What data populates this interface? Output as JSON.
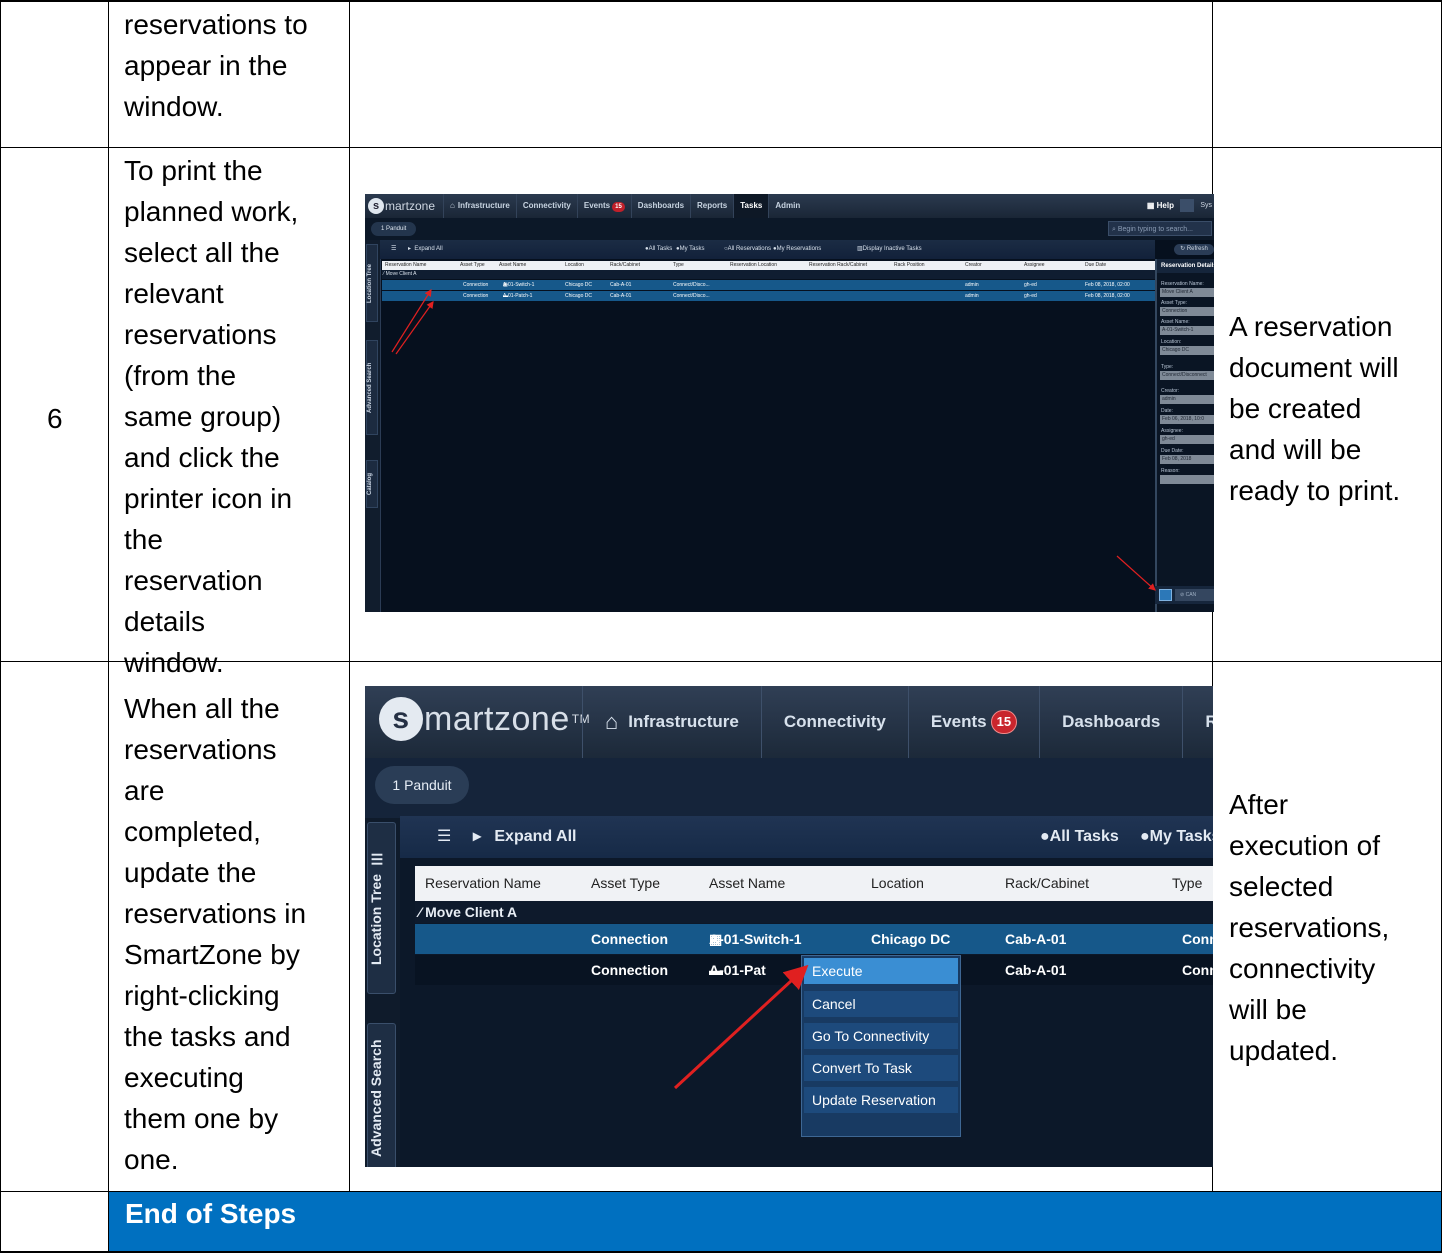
{
  "rows": [
    {
      "step": "",
      "instruction_lines": [
        "reservations to",
        "appear in the",
        "window."
      ],
      "result_lines": []
    },
    {
      "step": "6",
      "instruction_lines": [
        "To print the",
        "planned work,",
        "select all the",
        "relevant",
        "reservations",
        "(from the",
        "same group)",
        "and click the",
        "printer icon in",
        "the",
        "reservation",
        "details",
        "window."
      ],
      "result_lines": [
        "A reservation",
        "document will",
        "be created",
        "and will be",
        "ready to print."
      ]
    },
    {
      "step": "",
      "instruction_lines": [
        "When all the",
        "reservations",
        "are",
        "completed,",
        "update the",
        "reservations in",
        "SmartZone by",
        "right-clicking",
        "the tasks and",
        "executing",
        "them one by",
        "one."
      ],
      "result_lines": [
        "After",
        "execution of",
        "selected",
        "reservations,",
        "connectivity",
        "will be",
        "updated."
      ]
    }
  ],
  "end_banner": "End of Steps",
  "colors": {
    "banner": "#0070c0",
    "row_highlight": "#16588a",
    "menu_hover": "#3a8ed3",
    "badge": "#c9262d",
    "arrow": "#e02020"
  },
  "screenshot1": {
    "logo": "martzone",
    "logo_s": "s",
    "nav": [
      "Infrastructure",
      "Connectivity",
      "Events",
      "Dashboards",
      "Reports",
      "Tasks",
      "Admin"
    ],
    "events_badge": "15",
    "help": "Help",
    "user": "Sys",
    "location_chip": "1 Panduit",
    "search_placeholder": "Begin typing to search...",
    "toolbar": {
      "expand": "Expand All",
      "all_tasks": "All Tasks",
      "my_tasks": "My Tasks",
      "all_res": "All Reservations",
      "my_res": "My Reservations",
      "inactive": "Display Inactive Tasks",
      "refresh": "Refresh"
    },
    "columns": [
      "Reservation Name",
      "Asset Type",
      "Asset Name",
      "Location",
      "Rack/Cabinet",
      "Type",
      "Reservation Location",
      "Reservation Rack/Cabinet",
      "Rack Position",
      "Creator",
      "Assignee",
      "Due Date"
    ],
    "group": "Move Client A",
    "rows": [
      {
        "asset_type": "Connection",
        "asset_name": "A-01-Switch-1",
        "location": "Chicago DC",
        "rack": "Cab-A-01",
        "type": "Connect/Disco...",
        "creator": "admin",
        "assignee": "gh-ed",
        "due": "Feb 08, 2018, 02:00"
      },
      {
        "asset_type": "Connection",
        "asset_name": "A-01-Patch-1",
        "location": "Chicago DC",
        "rack": "Cab-A-01",
        "type": "Connect/Disco...",
        "creator": "admin",
        "assignee": "gh-ed",
        "due": "Feb 08, 2018, 02:00"
      }
    ],
    "side_tabs": [
      "Location Tree",
      "Advanced Search",
      "Catalog"
    ],
    "details": {
      "title": "Reservation Details",
      "fields": [
        {
          "label": "Reservation Name:",
          "value": "Move Client A"
        },
        {
          "label": "Asset Type:",
          "value": "Connection"
        },
        {
          "label": "Asset Name:",
          "value": "A-01-Switch-1"
        },
        {
          "label": "Location:",
          "value": "Chicago DC"
        },
        {
          "label": "Type:",
          "value": "Connect/Disconnect"
        },
        {
          "label": "Creator:",
          "value": "admin"
        },
        {
          "label": "Date:",
          "value": "Feb 06, 2018, 10:0"
        },
        {
          "label": "Assignee:",
          "value": "gh-ed"
        },
        {
          "label": "Due Date:",
          "value": "Feb 08, 2018"
        },
        {
          "label": "Reason:",
          "value": ""
        }
      ],
      "cancel": "CAN"
    }
  },
  "screenshot2": {
    "logo": "martzone",
    "logo_s": "s",
    "logo_tm": "TM",
    "nav": [
      "Infrastructure",
      "Connectivity",
      "Events",
      "Dashboards",
      "Re"
    ],
    "events_badge": "15",
    "location_chip": "1 Panduit",
    "toolbar": {
      "expand": "Expand All",
      "all_tasks": "All Tasks",
      "my_tasks": "My Tasks"
    },
    "columns": [
      "Reservation Name",
      "Asset Type",
      "Asset Name",
      "Location",
      "Rack/Cabinet",
      "Type"
    ],
    "group": "Move Client A",
    "rows": [
      {
        "asset_type": "Connection",
        "asset_name": "A-01-Switch-1",
        "location": "Chicago DC",
        "rack": "Cab-A-01",
        "type": "Conne"
      },
      {
        "asset_type": "Connection",
        "asset_name": "A-01-Pat",
        "location": "",
        "rack": "Cab-A-01",
        "type": "Conne"
      }
    ],
    "side_tabs": [
      "Location Tree",
      "Advanced Search"
    ],
    "context_menu": [
      "Execute",
      "Cancel",
      "Go To Connectivity",
      "Convert To Task",
      "Update Reservation"
    ]
  }
}
